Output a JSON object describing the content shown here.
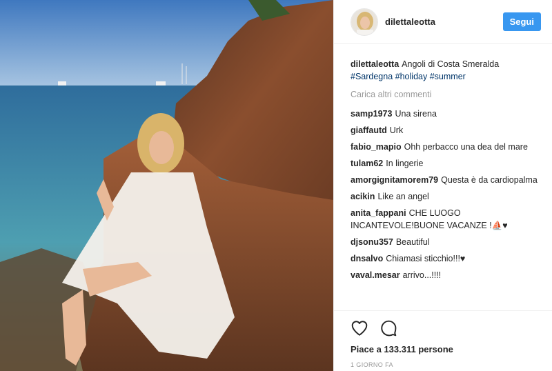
{
  "header": {
    "username": "dilettaleotta",
    "follow_label": "Segui"
  },
  "caption": {
    "username": "dilettaleotta",
    "text": "Angoli di Costa Smeralda",
    "hashtags": [
      "#Sardegna",
      "#holiday",
      "#summer"
    ]
  },
  "load_more_label": "Carica altri commenti",
  "comments": [
    {
      "user": "samp1973",
      "text": "Una sirena"
    },
    {
      "user": "giaffautd",
      "text": "Urk"
    },
    {
      "user": "fabio_mapio",
      "text": "Ohh perbacco una dea del mare"
    },
    {
      "user": "tulam62",
      "text": "In lingerie"
    },
    {
      "user": "amorgignitamorem79",
      "text": "Questa è da cardiopalma"
    },
    {
      "user": "acikin",
      "text": "Like an angel"
    },
    {
      "user": "anita_fappani",
      "text": "CHE LUOGO INCANTEVOLE!BUONE VACANZE !⛵♥"
    },
    {
      "user": "djsonu357",
      "text": "Beautiful"
    },
    {
      "user": "dnsalvo",
      "text": "Chiamasi sticchio!!!♥"
    },
    {
      "user": "vaval.mesar",
      "text": "arrivo...!!!!"
    }
  ],
  "footer": {
    "likes": "Piace a 133.311 persone",
    "time": "1 GIORNO FA"
  },
  "icons": {
    "like": "heart-icon",
    "comment": "comment-icon"
  },
  "colors": {
    "follow_button": "#3897f0",
    "hashtag": "#003569"
  }
}
